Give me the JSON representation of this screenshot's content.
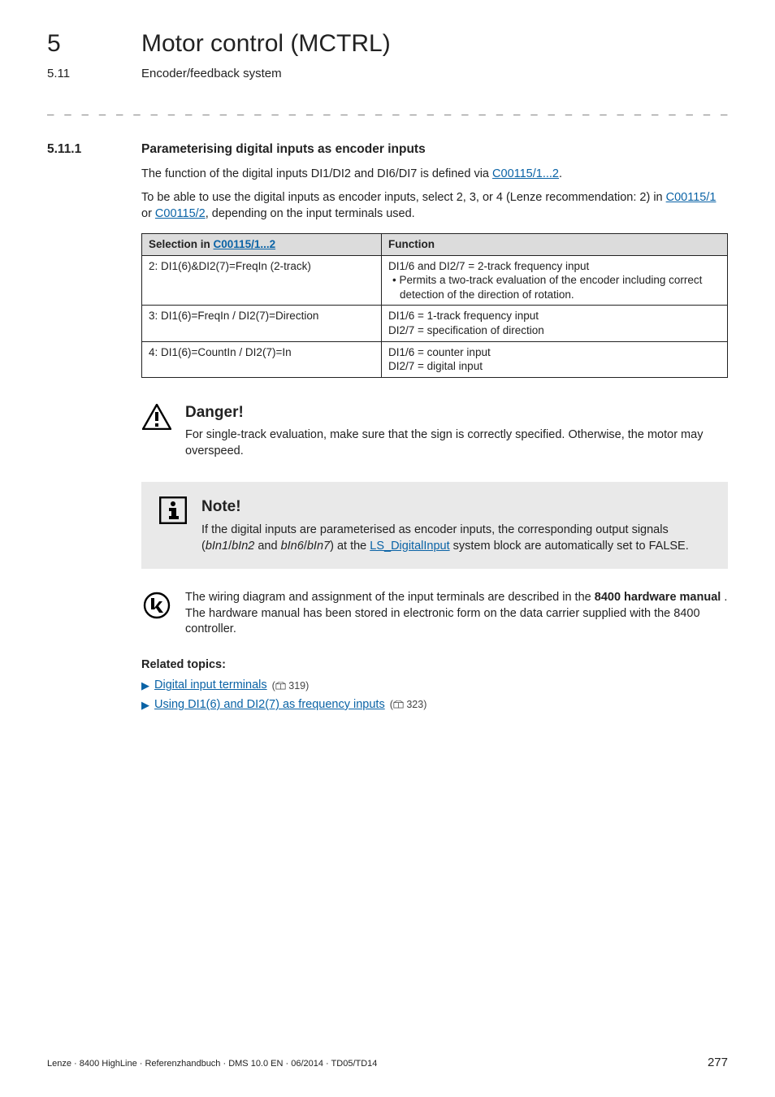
{
  "header": {
    "chapter_number": "5",
    "chapter_title": "Motor control (MCTRL)",
    "section_number": "5.11",
    "section_title": "Encoder/feedback system"
  },
  "divider": "_ _ _ _ _ _ _ _ _ _ _ _ _ _ _ _ _ _ _ _ _ _ _ _ _ _ _ _ _ _ _ _ _ _ _ _ _ _ _ _ _ _ _ _ _ _ _ _ _ _ _ _ _ _ _ _ _ _ _ _ _ _ _ _",
  "subsection": {
    "number": "5.11.1",
    "title": "Parameterising digital inputs as encoder inputs"
  },
  "intro": {
    "p1_pre": "The function of the digital inputs DI1/DI2 and DI6/DI7 is defined via ",
    "p1_link": "C00115/1...2",
    "p1_post": ".",
    "p2_pre": "To be able to use the digital inputs as encoder inputs, select 2, 3, or 4 (Lenze recommendation: 2) in ",
    "p2_link1": "C00115/1",
    "p2_mid": " or ",
    "p2_link2": "C00115/2",
    "p2_post": ", depending on the input terminals used."
  },
  "table": {
    "head_pre": "Selection in ",
    "head_link": "C00115/1...2",
    "head_col2": "Function",
    "rows": [
      {
        "sel": "2: DI1(6)&DI2(7)=FreqIn (2-track)",
        "func_line1": "DI1/6 and DI2/7 = 2-track frequency input",
        "func_bullet": "• Permits a two-track evaluation of the encoder including correct detection of the direction of rotation."
      },
      {
        "sel": "3: DI1(6)=FreqIn / DI2(7)=Direction",
        "func_line1": "DI1/6 = 1-track frequency input",
        "func_line2": "DI2/7 = specification of direction"
      },
      {
        "sel": "4: DI1(6)=CountIn / DI2(7)=In",
        "func_line1": "DI1/6 = counter input",
        "func_line2": "DI2/7 = digital input"
      }
    ]
  },
  "danger": {
    "title": "Danger!",
    "text": "For single-track evaluation, make sure that the sign is correctly specified. Otherwise, the motor may overspeed."
  },
  "note": {
    "title": "Note!",
    "pre": "If the digital inputs are parameterised as encoder inputs, the corresponding output signals (",
    "em1": "bIn1",
    "sep1": "/",
    "em2": "bIn2",
    "mid1": " and ",
    "em3": "bIn6",
    "sep2": "/",
    "em4": "bIn7",
    "mid2": ") at the ",
    "link": "LS_DigitalInput",
    "post": " system block are automatically set to FALSE."
  },
  "tip": {
    "pre": "The wiring diagram and assignment of the input terminals are described in the ",
    "bold": "8400 hardware manual",
    "post": " . The hardware manual has been stored in electronic form on the data carrier supplied with the 8400 controller."
  },
  "related": {
    "title": "Related topics:",
    "items": [
      {
        "text": "Digital input terminals",
        "page": "319"
      },
      {
        "text": "Using DI1(6) and DI2(7) as frequency inputs",
        "page": "323"
      }
    ]
  },
  "footer": {
    "left": "Lenze · 8400 HighLine · Referenzhandbuch · DMS 10.0 EN · 06/2014 · TD05/TD14",
    "right": "277"
  }
}
